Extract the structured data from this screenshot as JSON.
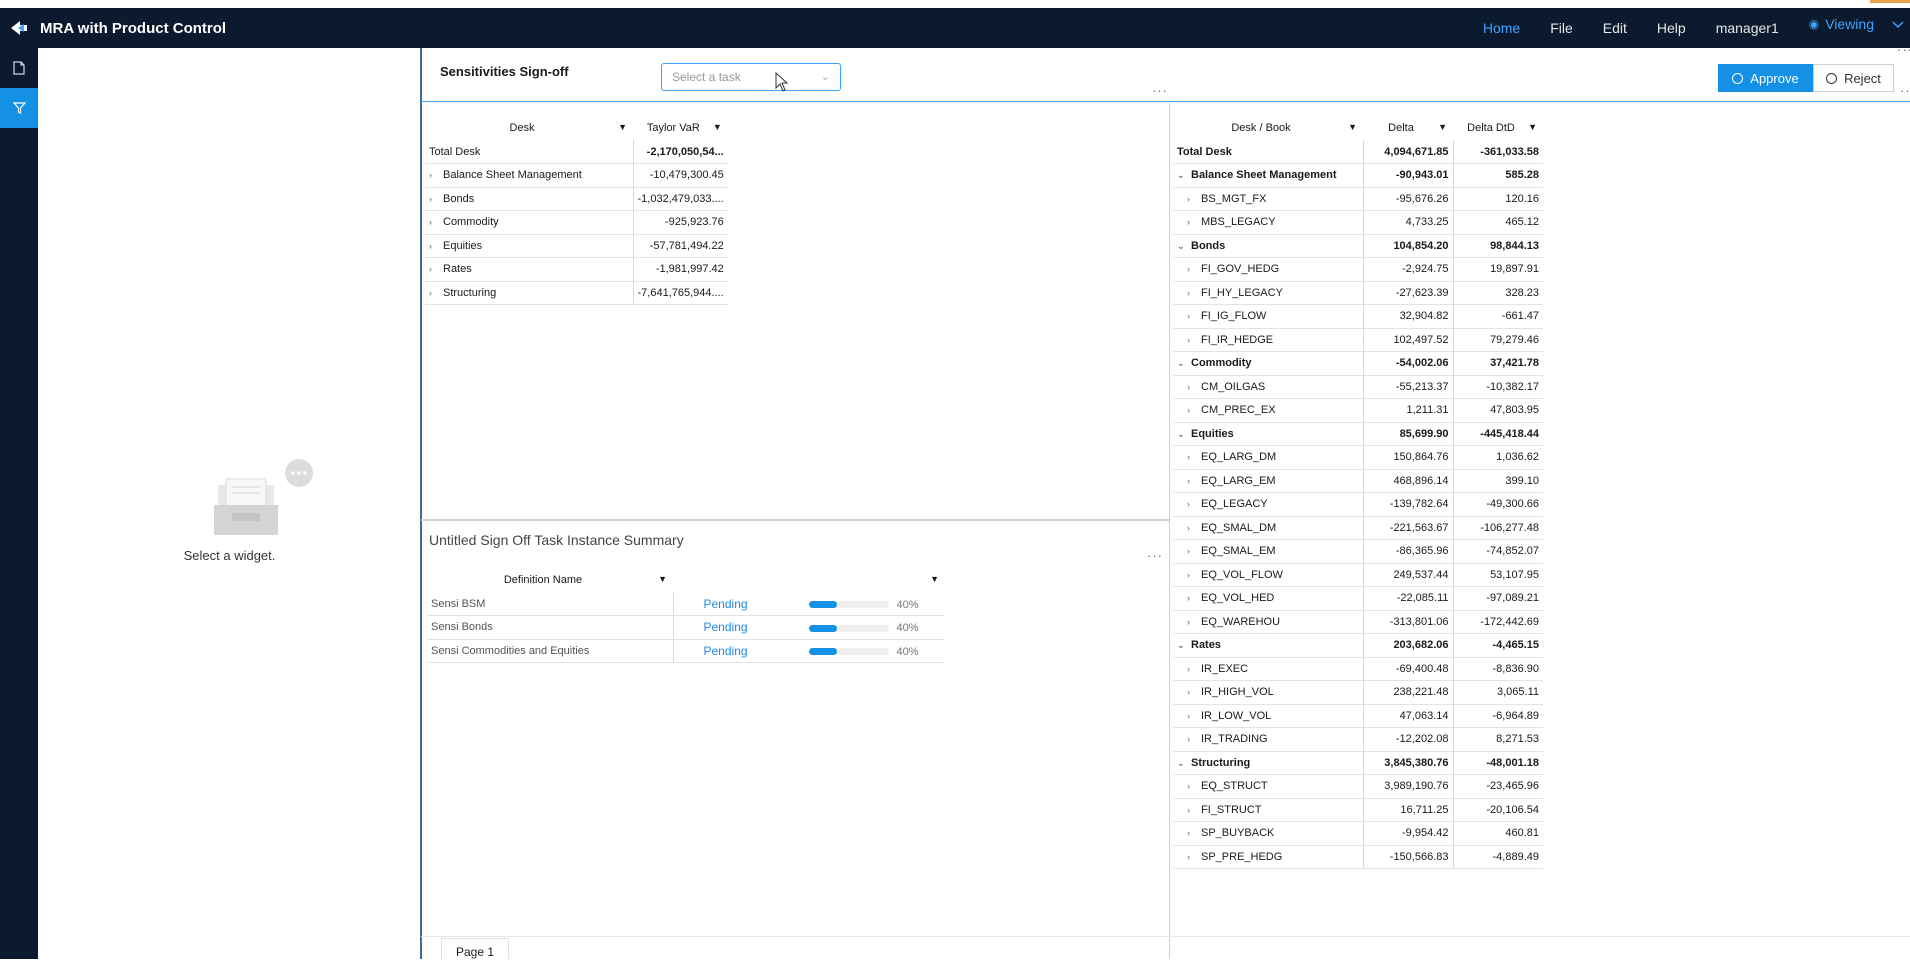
{
  "app": {
    "title": "MRA with Product Control"
  },
  "nav": {
    "home": "Home",
    "file": "File",
    "edit": "Edit",
    "help": "Help",
    "user": "manager1",
    "viewing": "Viewing"
  },
  "widgets": {
    "empty_label": "Select a widget."
  },
  "dashboard": {
    "title": "Sensitivities Sign-off",
    "task_placeholder": "Select a task",
    "approve": "Approve",
    "reject": "Reject",
    "page_tab": "Page 1"
  },
  "pivot_var": {
    "headers": [
      "Desk",
      "Taylor VaR"
    ],
    "total": {
      "label": "Total Desk",
      "value": "-2,170,050,54..."
    },
    "rows": [
      {
        "label": "Balance Sheet Management",
        "value": "-10,479,300.45"
      },
      {
        "label": "Bonds",
        "value": "-1,032,479,033...."
      },
      {
        "label": "Commodity",
        "value": "-925,923.76"
      },
      {
        "label": "Equities",
        "value": "-57,781,494.22"
      },
      {
        "label": "Rates",
        "value": "-1,981,997.42"
      },
      {
        "label": "Structuring",
        "value": "-7,641,765,944...."
      }
    ]
  },
  "pivot_delta": {
    "headers": [
      "Desk / Book",
      "Delta",
      "Delta DtD"
    ],
    "rows": [
      {
        "label": "Total Desk",
        "delta": "4,094,671.85",
        "dtd": "-361,033.58",
        "level": 0,
        "bold": true
      },
      {
        "label": "Balance Sheet Management",
        "delta": "-90,943.01",
        "dtd": "585.28",
        "level": 1,
        "bold": true
      },
      {
        "label": "BS_MGT_FX",
        "delta": "-95,676.26",
        "dtd": "120.16",
        "level": 2
      },
      {
        "label": "MBS_LEGACY",
        "delta": "4,733.25",
        "dtd": "465.12",
        "level": 2
      },
      {
        "label": "Bonds",
        "delta": "104,854.20",
        "dtd": "98,844.13",
        "level": 1,
        "bold": true
      },
      {
        "label": "FI_GOV_HEDG",
        "delta": "-2,924.75",
        "dtd": "19,897.91",
        "level": 2
      },
      {
        "label": "FI_HY_LEGACY",
        "delta": "-27,623.39",
        "dtd": "328.23",
        "level": 2
      },
      {
        "label": "FI_IG_FLOW",
        "delta": "32,904.82",
        "dtd": "-661.47",
        "level": 2
      },
      {
        "label": "FI_IR_HEDGE",
        "delta": "102,497.52",
        "dtd": "79,279.46",
        "level": 2
      },
      {
        "label": "Commodity",
        "delta": "-54,002.06",
        "dtd": "37,421.78",
        "level": 1,
        "bold": true
      },
      {
        "label": "CM_OILGAS",
        "delta": "-55,213.37",
        "dtd": "-10,382.17",
        "level": 2
      },
      {
        "label": "CM_PREC_EX",
        "delta": "1,211.31",
        "dtd": "47,803.95",
        "level": 2
      },
      {
        "label": "Equities",
        "delta": "85,699.90",
        "dtd": "-445,418.44",
        "level": 1,
        "bold": true
      },
      {
        "label": "EQ_LARG_DM",
        "delta": "150,864.76",
        "dtd": "1,036.62",
        "level": 2
      },
      {
        "label": "EQ_LARG_EM",
        "delta": "468,896.14",
        "dtd": "399.10",
        "level": 2
      },
      {
        "label": "EQ_LEGACY",
        "delta": "-139,782.64",
        "dtd": "-49,300.66",
        "level": 2
      },
      {
        "label": "EQ_SMAL_DM",
        "delta": "-221,563.67",
        "dtd": "-106,277.48",
        "level": 2
      },
      {
        "label": "EQ_SMAL_EM",
        "delta": "-86,365.96",
        "dtd": "-74,852.07",
        "level": 2
      },
      {
        "label": "EQ_VOL_FLOW",
        "delta": "249,537.44",
        "dtd": "53,107.95",
        "level": 2
      },
      {
        "label": "EQ_VOL_HED",
        "delta": "-22,085.11",
        "dtd": "-97,089.21",
        "level": 2
      },
      {
        "label": "EQ_WAREHOU",
        "delta": "-313,801.06",
        "dtd": "-172,442.69",
        "level": 2
      },
      {
        "label": "Rates",
        "delta": "203,682.06",
        "dtd": "-4,465.15",
        "level": 1,
        "bold": true
      },
      {
        "label": "IR_EXEC",
        "delta": "-69,400.48",
        "dtd": "-8,836.90",
        "level": 2
      },
      {
        "label": "IR_HIGH_VOL",
        "delta": "238,221.48",
        "dtd": "3,065.11",
        "level": 2
      },
      {
        "label": "IR_LOW_VOL",
        "delta": "47,063.14",
        "dtd": "-6,964.89",
        "level": 2
      },
      {
        "label": "IR_TRADING",
        "delta": "-12,202.08",
        "dtd": "8,271.53",
        "level": 2
      },
      {
        "label": "Structuring",
        "delta": "3,845,380.76",
        "dtd": "-48,001.18",
        "level": 1,
        "bold": true
      },
      {
        "label": "EQ_STRUCT",
        "delta": "3,989,190.76",
        "dtd": "-23,465.96",
        "level": 2
      },
      {
        "label": "FI_STRUCT",
        "delta": "16,711.25",
        "dtd": "-20,106.54",
        "level": 2
      },
      {
        "label": "SP_BUYBACK",
        "delta": "-9,954.42",
        "dtd": "460.81",
        "level": 2
      },
      {
        "label": "SP_PRE_HEDG",
        "delta": "-150,566.83",
        "dtd": "-4,889.49",
        "level": 2
      }
    ]
  },
  "summary": {
    "title": "Untitled Sign Off Task Instance Summary",
    "header": "Definition Name",
    "rows": [
      {
        "name": "Sensi BSM",
        "status": "Pending",
        "progress": 40,
        "pct": "40%"
      },
      {
        "name": "Sensi Bonds",
        "status": "Pending",
        "progress": 40,
        "pct": "40%"
      },
      {
        "name": "Sensi Commodities and Equities",
        "status": "Pending",
        "progress": 40,
        "pct": "40%"
      }
    ]
  },
  "colors": {
    "topbar": "#0b1a2e",
    "accent": "#1490e5",
    "link": "#3ea3ff"
  }
}
